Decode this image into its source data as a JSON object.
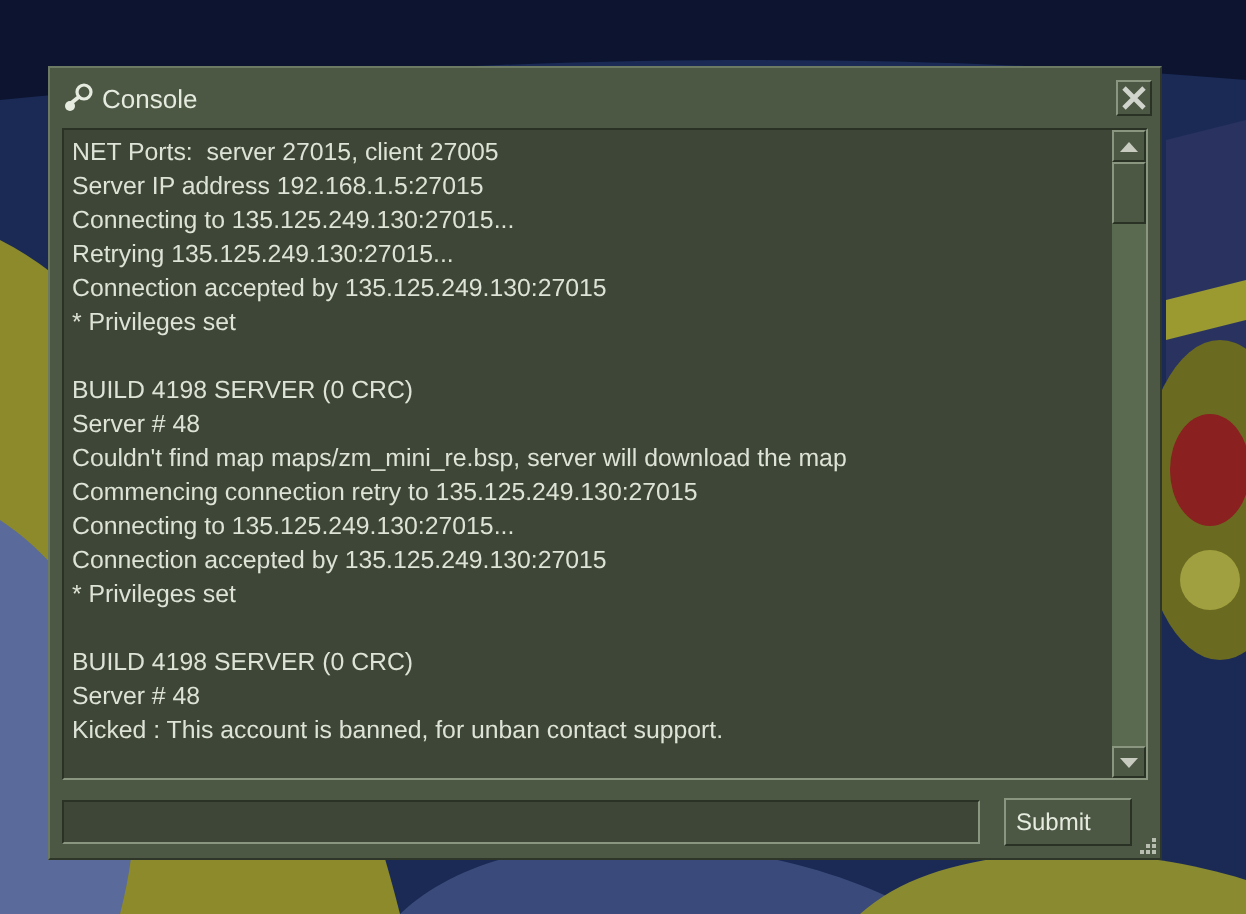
{
  "window": {
    "title": "Console"
  },
  "log": [
    [
      "NET Ports:  server 27015, client 27005",
      "Server IP address 192.168.1.5:27015",
      "Connecting to 135.125.249.130:27015...",
      "Retrying 135.125.249.130:27015...",
      "Connection accepted by 135.125.249.130:27015",
      "* Privileges set"
    ],
    [
      "BUILD 4198 SERVER (0 CRC)",
      "Server # 48",
      "Couldn't find map maps/zm_mini_re.bsp, server will download the map",
      "Commencing connection retry to 135.125.249.130:27015",
      "Connecting to 135.125.249.130:27015...",
      "Connection accepted by 135.125.249.130:27015",
      "* Privileges set"
    ],
    [
      "BUILD 4198 SERVER (0 CRC)",
      "Server # 48",
      "Kicked : This account is banned, for unban contact support."
    ]
  ],
  "buttons": [
    "Submit"
  ]
}
